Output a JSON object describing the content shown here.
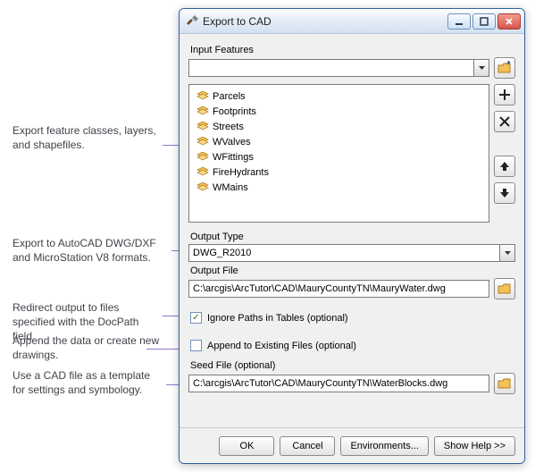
{
  "window": {
    "title": "Export to CAD"
  },
  "labels": {
    "input_features": "Input Features",
    "output_type": "Output Type",
    "output_file": "Output File",
    "ignore_paths": "Ignore Paths in Tables (optional)",
    "append_existing": "Append to Existing Files (optional)",
    "seed_file": "Seed File (optional)"
  },
  "input_features": {
    "selected": "",
    "items": [
      {
        "label": "Parcels"
      },
      {
        "label": "Footprints"
      },
      {
        "label": "Streets"
      },
      {
        "label": "WValves"
      },
      {
        "label": "WFittings"
      },
      {
        "label": "FireHydrants"
      },
      {
        "label": "WMains"
      }
    ]
  },
  "output_type": "DWG_R2010",
  "output_file": "C:\\arcgis\\ArcTutor\\CAD\\MauryCountyTN\\MauryWater.dwg",
  "ignore_paths_checked": true,
  "append_existing_checked": false,
  "seed_file": "C:\\arcgis\\ArcTutor\\CAD\\MauryCountyTN\\WaterBlocks.dwg",
  "buttons": {
    "ok": "OK",
    "cancel": "Cancel",
    "environments": "Environments...",
    "show_help": "Show Help >>"
  },
  "annotations": {
    "a1": "Export feature classes, layers, and shapefiles.",
    "a2": "Export to AutoCAD DWG/DXF and MicroStation V8 formats.",
    "a3": "Redirect output to files specified with the DocPath field.",
    "a4": "Append the data or create new drawings.",
    "a5": "Use a CAD file as a template for settings and symbology."
  }
}
